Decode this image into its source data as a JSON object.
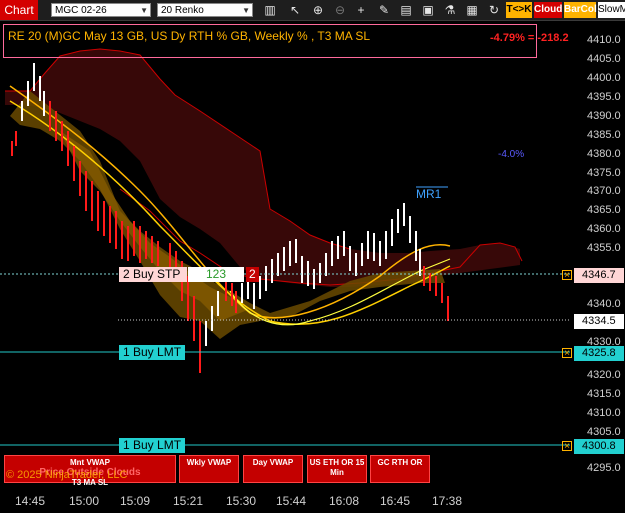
{
  "toolbar": {
    "title": "Chart",
    "instrument": "MGC 02-26",
    "bar_type": "20 Renko",
    "buttons": [
      "T<>K",
      "Cloud",
      "BarCol",
      "SlowM"
    ]
  },
  "indicator": {
    "text": "RE 20  (M)GC May 13 GB, US Dy RTH % GB, Weekly % , T3 MA SL",
    "pct": "-4.79% = -218.2",
    "annot_pct": "-4.0%",
    "mr1": "MR1",
    "copyright": "© 2025 NinjaTrader, LLC",
    "overlay_text": "Price Outside Clouds"
  },
  "orders": {
    "stop_label": "2 Buy STP",
    "stop_mid": "123",
    "stop_qty": "2",
    "stop_price": "4346.7",
    "limit1_label": "1 Buy LMT",
    "limit1_price": "4325.8",
    "limit2_label": "1 Buy LMT",
    "limit2_price": "4300.8",
    "current_price": "4334.5"
  },
  "price_axis": [
    "4410.0",
    "4405.0",
    "4400.0",
    "4395.0",
    "4390.0",
    "4385.0",
    "4380.0",
    "4375.0",
    "4370.0",
    "4365.0",
    "4360.0",
    "4355.0",
    "4350.0",
    "4345.0",
    "4340.0",
    "4335.0",
    "4330.0",
    "4325.0",
    "4320.0",
    "4315.0",
    "4310.0",
    "4305.0",
    "4300.0",
    "4295.0"
  ],
  "time_axis": [
    "14:45",
    "15:00",
    "15:09",
    "15:21",
    "15:30",
    "15:44",
    "16:08",
    "16:45",
    "17:38"
  ],
  "bottom_buttons": [
    {
      "l1": "Mnt VWAP",
      "l2": "T3 MA SL"
    },
    {
      "l1": "Wkly VWAP",
      "l2": ""
    },
    {
      "l1": "Day VWAP",
      "l2": ""
    },
    {
      "l1": "US ETH OR 15",
      "l2": "Min"
    },
    {
      "l1": "GC RTH OR",
      "l2": ""
    }
  ],
  "colors": {
    "up": "#ffffff",
    "down": "#ff1a1a",
    "accent": "#ffb300",
    "brand": "#d40000"
  }
}
